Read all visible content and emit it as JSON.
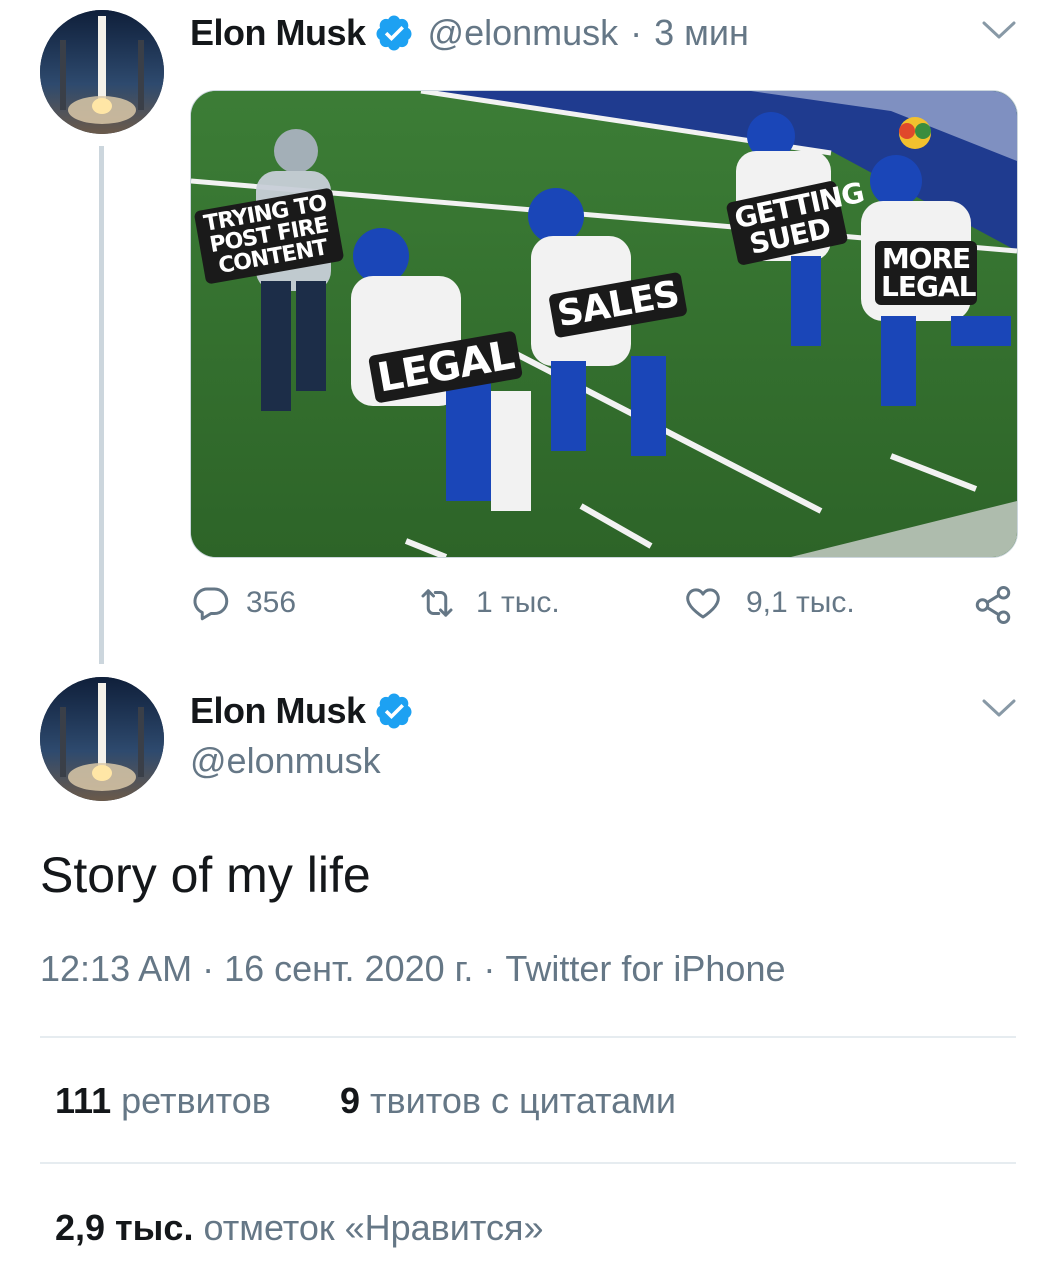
{
  "tweet1": {
    "author_name": "Elon Musk",
    "handle": "@elonmusk",
    "separator": "·",
    "time": "3 мин",
    "media_labels": {
      "label1": "TRYING TO POST FIRE CONTENT",
      "label2": "LEGAL",
      "label3": "SALES",
      "label4": "GETTING SUED",
      "label5": "MORE LEGAL"
    },
    "actions": {
      "replies": "356",
      "retweets": "1 тыс.",
      "likes": "9,1 тыс."
    }
  },
  "tweet2": {
    "author_name": "Elon Musk",
    "handle": "@elonmusk",
    "text": "Story of my life",
    "meta": "12:13 AM · 16 сент. 2020 г. · Twitter for iPhone",
    "retweets_count": "111",
    "retweets_label": "ретвитов",
    "quotes_count": "9",
    "quotes_label": "твитов с цитатами",
    "likes_count": "2,9 тыс.",
    "likes_label": "отметок «Нравится»"
  },
  "colors": {
    "verified_blue": "#1da1f2",
    "secondary_text": "#657786",
    "divider": "#e6ecf0"
  },
  "icons": [
    "verified-badge-icon",
    "chevron-down-icon",
    "reply-icon",
    "retweet-icon",
    "like-icon",
    "share-icon"
  ]
}
